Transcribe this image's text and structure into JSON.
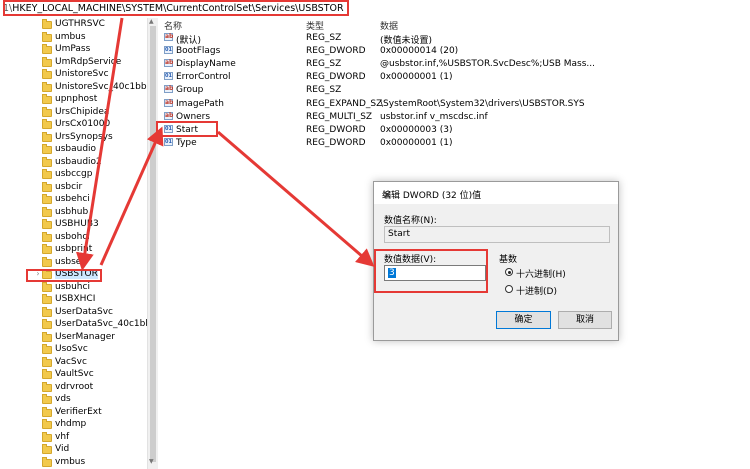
{
  "address": {
    "path": "HKEY_LOCAL_MACHINE\\SYSTEM\\CurrentControlSet\\Services\\USBSTOR",
    "prefix": "1\\"
  },
  "tree": {
    "items": [
      {
        "label": "UGTHRSVC"
      },
      {
        "label": "umbus"
      },
      {
        "label": "UmPass"
      },
      {
        "label": "UmRdpService"
      },
      {
        "label": "UnistoreSvc"
      },
      {
        "label": "UnistoreSvc_40c1bb15"
      },
      {
        "label": "upnphost"
      },
      {
        "label": "UrsChipidea"
      },
      {
        "label": "UrsCx01000"
      },
      {
        "label": "UrsSynopsys"
      },
      {
        "label": "usbaudio"
      },
      {
        "label": "usbaudio2"
      },
      {
        "label": "usbccgp"
      },
      {
        "label": "usbcir"
      },
      {
        "label": "usbehci"
      },
      {
        "label": "usbhub"
      },
      {
        "label": "USBHUB3"
      },
      {
        "label": "usbohci"
      },
      {
        "label": "usbprint"
      },
      {
        "label": "usbser"
      },
      {
        "label": "USBSTOR",
        "selected": true,
        "expandable": true
      },
      {
        "label": "usbuhci"
      },
      {
        "label": "USBXHCI"
      },
      {
        "label": "UserDataSvc"
      },
      {
        "label": "UserDataSvc_40c1bb15"
      },
      {
        "label": "UserManager"
      },
      {
        "label": "UsoSvc"
      },
      {
        "label": "VacSvc"
      },
      {
        "label": "VaultSvc"
      },
      {
        "label": "vdrvroot"
      },
      {
        "label": "vds"
      },
      {
        "label": "VerifierExt"
      },
      {
        "label": "vhdmp"
      },
      {
        "label": "vhf"
      },
      {
        "label": "Vid"
      },
      {
        "label": "vmbus"
      },
      {
        "label": "VMBusHID"
      }
    ]
  },
  "values_pane": {
    "headers": {
      "name": "名称",
      "type": "类型",
      "data": "数据"
    },
    "rows": [
      {
        "name": "(默认)",
        "type": "REG_SZ",
        "data": "(数值未设置)",
        "icon": "string-value-icon"
      },
      {
        "name": "BootFlags",
        "type": "REG_DWORD",
        "data": "0x00000014 (20)",
        "icon": "binary-value-icon"
      },
      {
        "name": "DisplayName",
        "type": "REG_SZ",
        "data": "@usbstor.inf,%USBSTOR.SvcDesc%;USB Mass...",
        "icon": "string-value-icon"
      },
      {
        "name": "ErrorControl",
        "type": "REG_DWORD",
        "data": "0x00000001 (1)",
        "icon": "binary-value-icon"
      },
      {
        "name": "Group",
        "type": "REG_SZ",
        "data": "",
        "icon": "string-value-icon"
      },
      {
        "name": "ImagePath",
        "type": "REG_EXPAND_SZ",
        "data": "\\SystemRoot\\System32\\drivers\\USBSTOR.SYS",
        "icon": "string-value-icon"
      },
      {
        "name": "Owners",
        "type": "REG_MULTI_SZ",
        "data": "usbstor.inf v_mscdsc.inf",
        "icon": "string-value-icon"
      },
      {
        "name": "Start",
        "type": "REG_DWORD",
        "data": "0x00000003 (3)",
        "icon": "binary-value-icon"
      },
      {
        "name": "Type",
        "type": "REG_DWORD",
        "data": "0x00000001 (1)",
        "icon": "binary-value-icon"
      }
    ]
  },
  "dialog": {
    "title": "编辑 DWORD (32 位)值",
    "close": "✕",
    "name_label": "数值名称(N):",
    "name_value": "Start",
    "data_label": "数值数据(V):",
    "data_value": "3",
    "base_label": "基数",
    "hex_label": "十六进制(H)",
    "dec_label": "十进制(D)",
    "hex_selected": true,
    "ok_label": "确定",
    "cancel_label": "取消"
  },
  "colors": {
    "highlight": "#e53935",
    "selection": "#cce8ff",
    "accent": "#0078d7"
  }
}
